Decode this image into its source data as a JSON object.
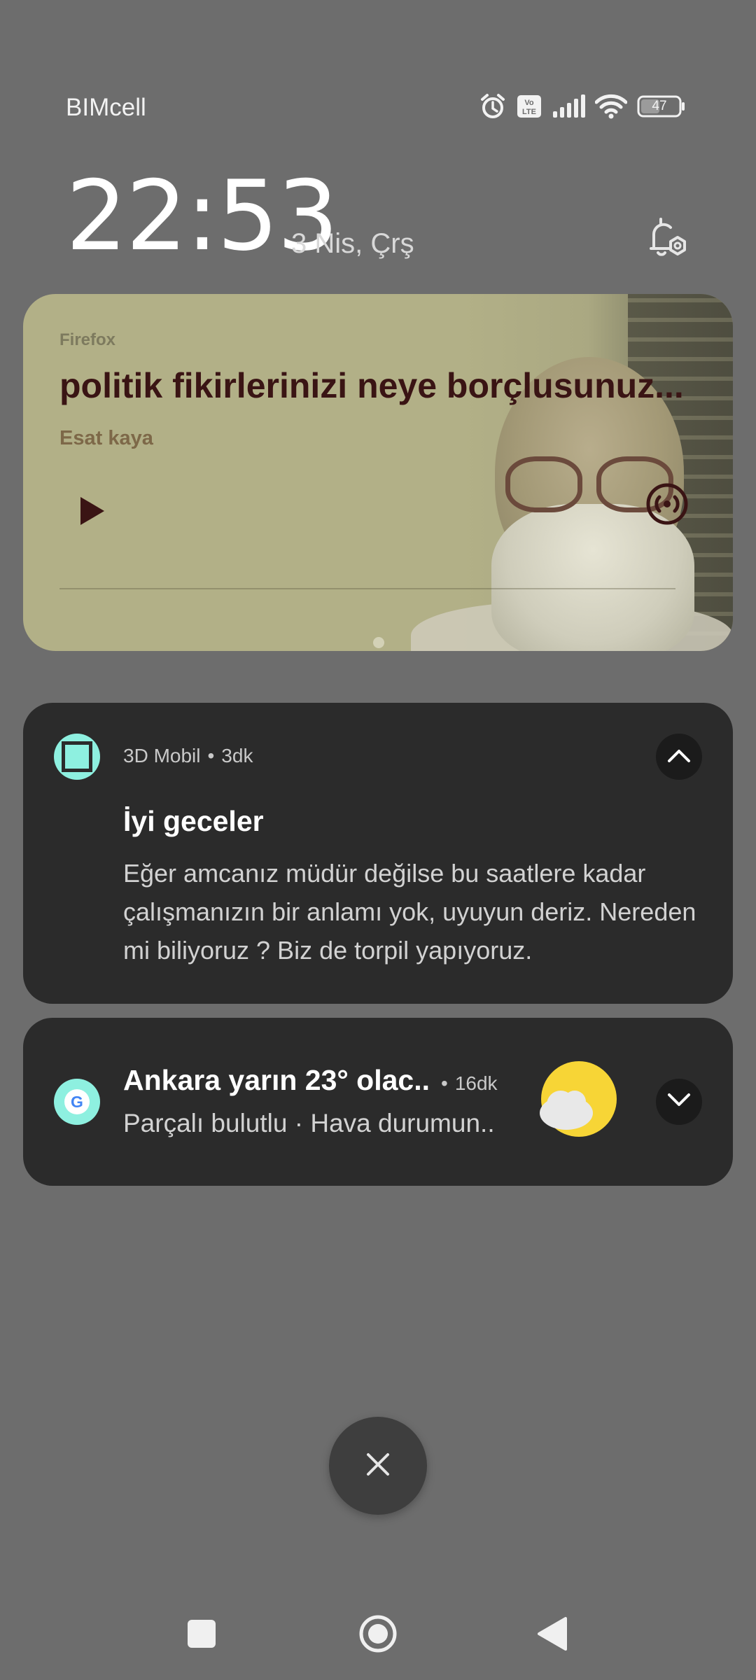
{
  "status_bar": {
    "carrier": "BIMcell",
    "battery": "47",
    "icons": [
      "alarm-icon",
      "volte-icon",
      "signal-icon",
      "wifi-icon",
      "battery-icon"
    ]
  },
  "lockscreen": {
    "time": "22:53",
    "date": "3 Nis, Çrş"
  },
  "media": {
    "app": "Firefox",
    "title": "politik fikirlerinizi neye borçlusunuz...",
    "artist": "Esat kaya",
    "accent_color": "#b2b087",
    "title_color": "#3a1414"
  },
  "notifications": [
    {
      "app": "3D Mobil",
      "time": "3dk",
      "title": "İyi geceler",
      "body": "Eğer amcanız müdür değilse bu saatlere kadar çalışmanızın bir anlamı yok, uyuyun deriz. Nereden mi biliyoruz ? Biz de torpil yapıyoruz.",
      "expanded": true
    },
    {
      "app": "Google",
      "title": "Ankara yarın 23° olac..",
      "time": "16dk",
      "body": "Parçalı bulutlu · Hava durumun..",
      "expanded": false
    }
  ],
  "colors": {
    "background": "#6d6d6d",
    "card": "#2b2b2b",
    "app_icon": "#8ef0e0"
  }
}
